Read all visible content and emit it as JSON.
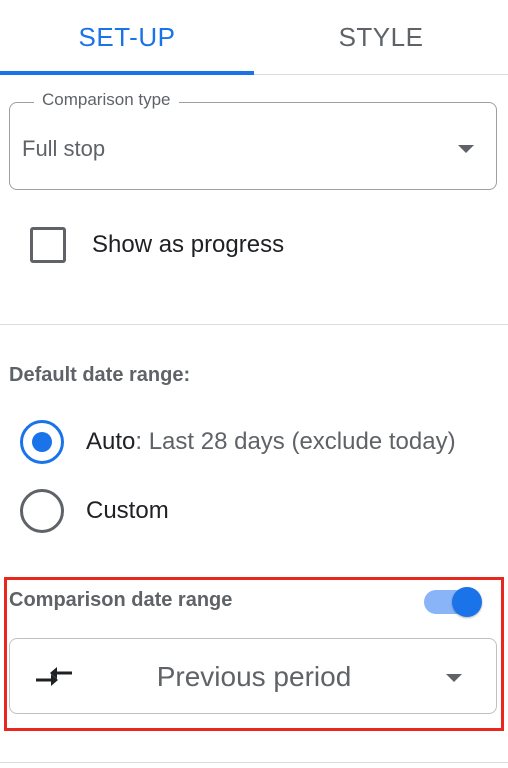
{
  "tabs": [
    {
      "label": "SET-UP",
      "active": true
    },
    {
      "label": "STYLE",
      "active": false
    }
  ],
  "comparison_type": {
    "label": "Comparison type",
    "value": "Full stop",
    "icon": "caret-down-icon"
  },
  "show_progress": {
    "label": "Show as progress",
    "checked": false
  },
  "default_date_range": {
    "title": "Default date range:",
    "options": [
      {
        "label": "Auto",
        "detail": ": Last 28 days (exclude today)",
        "selected": true
      },
      {
        "label": "Custom",
        "detail": "",
        "selected": false
      }
    ]
  },
  "comparison_date_range": {
    "title": "Comparison date range",
    "enabled": true,
    "value": "Previous period",
    "icon": "compare-arrows-icon",
    "dropdown_icon": "caret-down-icon",
    "highlight_color": "#e8281e"
  },
  "colors": {
    "accent": "#1a73e8",
    "accent_light": "#8ab4f8",
    "text_secondary": "#5f6368",
    "highlight": "#e8281e"
  }
}
